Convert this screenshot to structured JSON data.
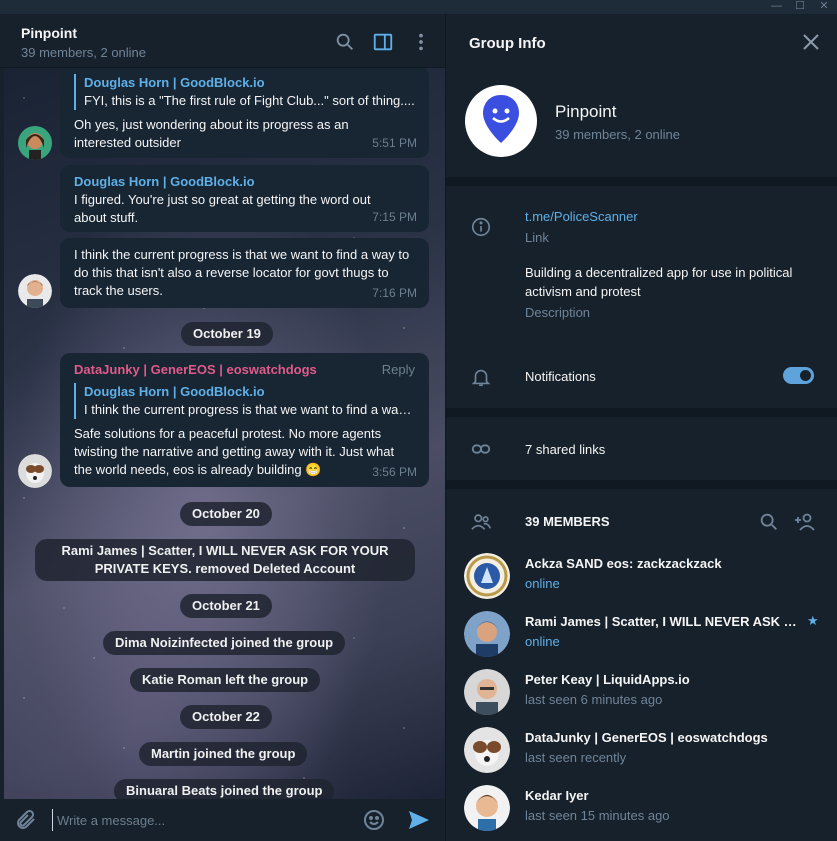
{
  "window": {
    "controls": [
      "—",
      "☐",
      "✕"
    ]
  },
  "chat": {
    "title": "Pinpoint",
    "subtitle": "39 members, 2 online",
    "messages": [
      {
        "quote_name": "Douglas Horn | GoodBlock.io",
        "quote_text": "FYI, this is a \"The first rule of Fight Club...\" sort of thing....",
        "text": "Oh yes, just wondering about its progress as an interested outsider",
        "time": "5:51 PM"
      },
      {
        "sender": "Douglas Horn | GoodBlock.io",
        "text": "I figured. You're just so great at getting the word out about stuff.",
        "time": "7:15 PM"
      },
      {
        "text": "I think the current progress is that we want to find a way to do this that isn't also a reverse locator for govt thugs to track the users.",
        "time": "7:16 PM"
      },
      {
        "sender": "DataJunky | GenerEOS | eoswatchdogs",
        "reply_label": "Reply",
        "quote_name": "Douglas Horn | GoodBlock.io",
        "quote_text": "I think the current progress is that we want to find a way to...",
        "text": "Safe solutions for a peaceful protest. No more agents twisting the narrative and getting away with it. Just what the world needs, eos is already building 😁",
        "time": "3:56 PM"
      }
    ],
    "service": {
      "date1": "October 19",
      "date2": "October 20",
      "event1": "Rami James | Scatter, I WILL NEVER ASK FOR YOUR PRIVATE KEYS. removed Deleted Account",
      "date3": "October 21",
      "event2": "Dima Noizinfected joined the group",
      "event3": "Katie Roman left the group",
      "date4": "October 22",
      "event4": "Martin joined the group",
      "event5": "Binuaral Beats joined the group"
    },
    "composer_placeholder": "Write a message..."
  },
  "info": {
    "title": "Group Info",
    "group_name": "Pinpoint",
    "group_sub": "39 members, 2 online",
    "link": "t.me/PoliceScanner",
    "link_label": "Link",
    "description": "Building a decentralized app for use in political activism and protest",
    "description_label": "Description",
    "notifications_label": "Notifications",
    "notifications_on": true,
    "shared_links": "7 shared links",
    "members_head": "39 MEMBERS",
    "members": [
      {
        "name": "Ackza SAND eos: zackzackzack",
        "status": "online"
      },
      {
        "name": "Rami James | Scatter, I WILL NEVER ASK FOR YOUR PRIVATE KEYS.",
        "status": "online"
      },
      {
        "name": "Peter Keay | LiquidApps.io",
        "status": "last seen 6 minutes ago"
      },
      {
        "name": "DataJunky | GenerEOS | eoswatchdogs",
        "status": "last seen recently"
      },
      {
        "name": "Kedar Iyer",
        "status": "last seen 15 minutes ago"
      }
    ]
  },
  "colors": {
    "accent": "#5fb0e8",
    "bg": "#17212b",
    "bubble": "#182533",
    "pink_sender": "#e05a8a",
    "group_icon": "#3a4fe0"
  },
  "icons": [
    "search-icon",
    "sidebar-toggle-icon",
    "more-icon",
    "close-icon",
    "info-icon",
    "bell-icon",
    "link-icon",
    "members-icon",
    "add-member-icon",
    "attach-icon",
    "emoji-icon",
    "send-icon"
  ]
}
